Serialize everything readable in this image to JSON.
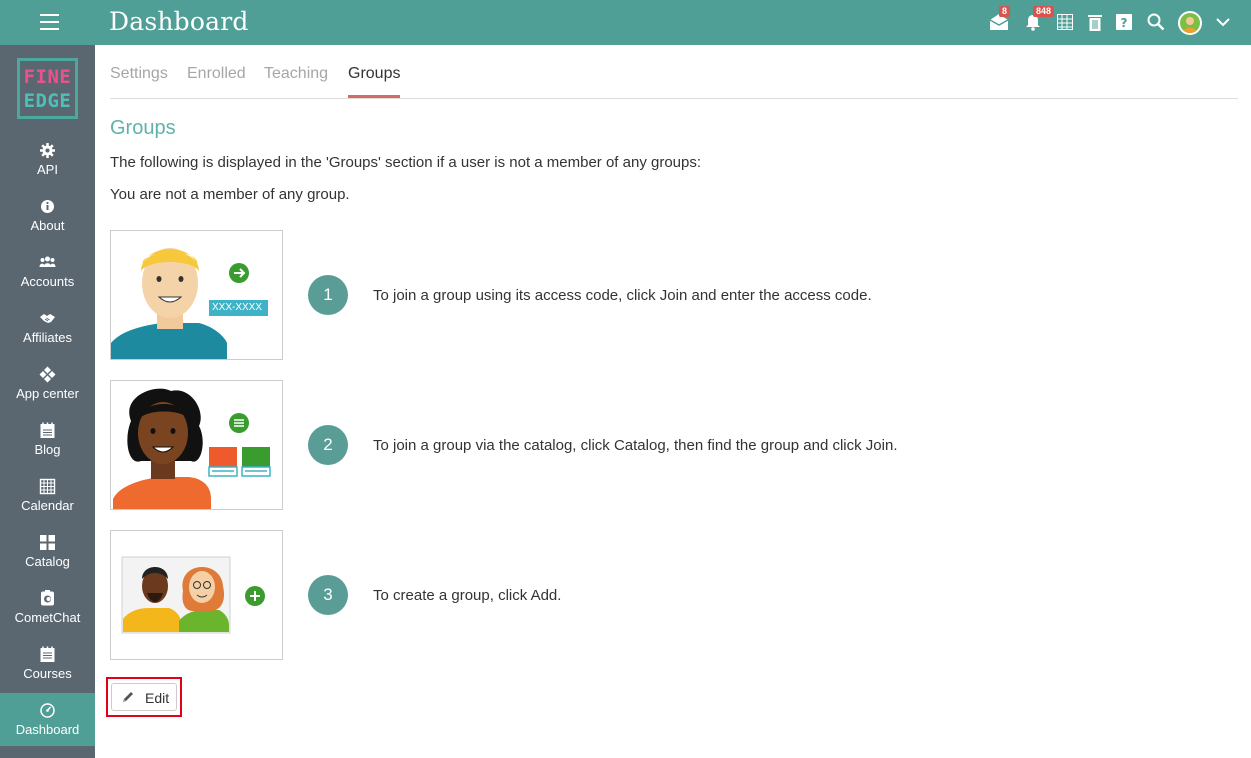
{
  "header": {
    "title": "Dashboard",
    "mail_badge": "8",
    "notifications_badge": "848"
  },
  "sidebar": {
    "logo_line1": "FINE",
    "logo_line2": "EDGE",
    "items": [
      {
        "label": "API",
        "icon": "gear-icon"
      },
      {
        "label": "About",
        "icon": "info-icon"
      },
      {
        "label": "Accounts",
        "icon": "users-icon"
      },
      {
        "label": "Affiliates",
        "icon": "handshake-icon"
      },
      {
        "label": "App center",
        "icon": "app-center-icon"
      },
      {
        "label": "Blog",
        "icon": "blog-icon"
      },
      {
        "label": "Calendar",
        "icon": "calendar-icon"
      },
      {
        "label": "Catalog",
        "icon": "grid-icon"
      },
      {
        "label": "CometChat",
        "icon": "cometchat-icon"
      },
      {
        "label": "Courses",
        "icon": "courses-icon"
      },
      {
        "label": "Dashboard",
        "icon": "dashboard-icon"
      }
    ]
  },
  "tabs": [
    {
      "label": "Settings"
    },
    {
      "label": "Enrolled"
    },
    {
      "label": "Teaching"
    },
    {
      "label": "Groups",
      "active": true
    }
  ],
  "main": {
    "section_title": "Groups",
    "description": "The following is displayed in the 'Groups' section if a user is not a member of any groups:",
    "not_member_text": "You are not a member of any group.",
    "access_code_placeholder": "XXX-XXXX",
    "steps": [
      {
        "number": "1",
        "text": "To join a group using its access code, click Join and enter the access code."
      },
      {
        "number": "2",
        "text": "To join a group via the catalog, click Catalog, then find the group and click Join."
      },
      {
        "number": "3",
        "text": "To create a group, click Add."
      }
    ],
    "edit_label": "Edit"
  },
  "colors": {
    "primary": "#4f9f96",
    "sidebar": "#5a6771",
    "accent_tab": "#d46b65",
    "badge": "#d9534f",
    "highlight": "#e3001b"
  }
}
